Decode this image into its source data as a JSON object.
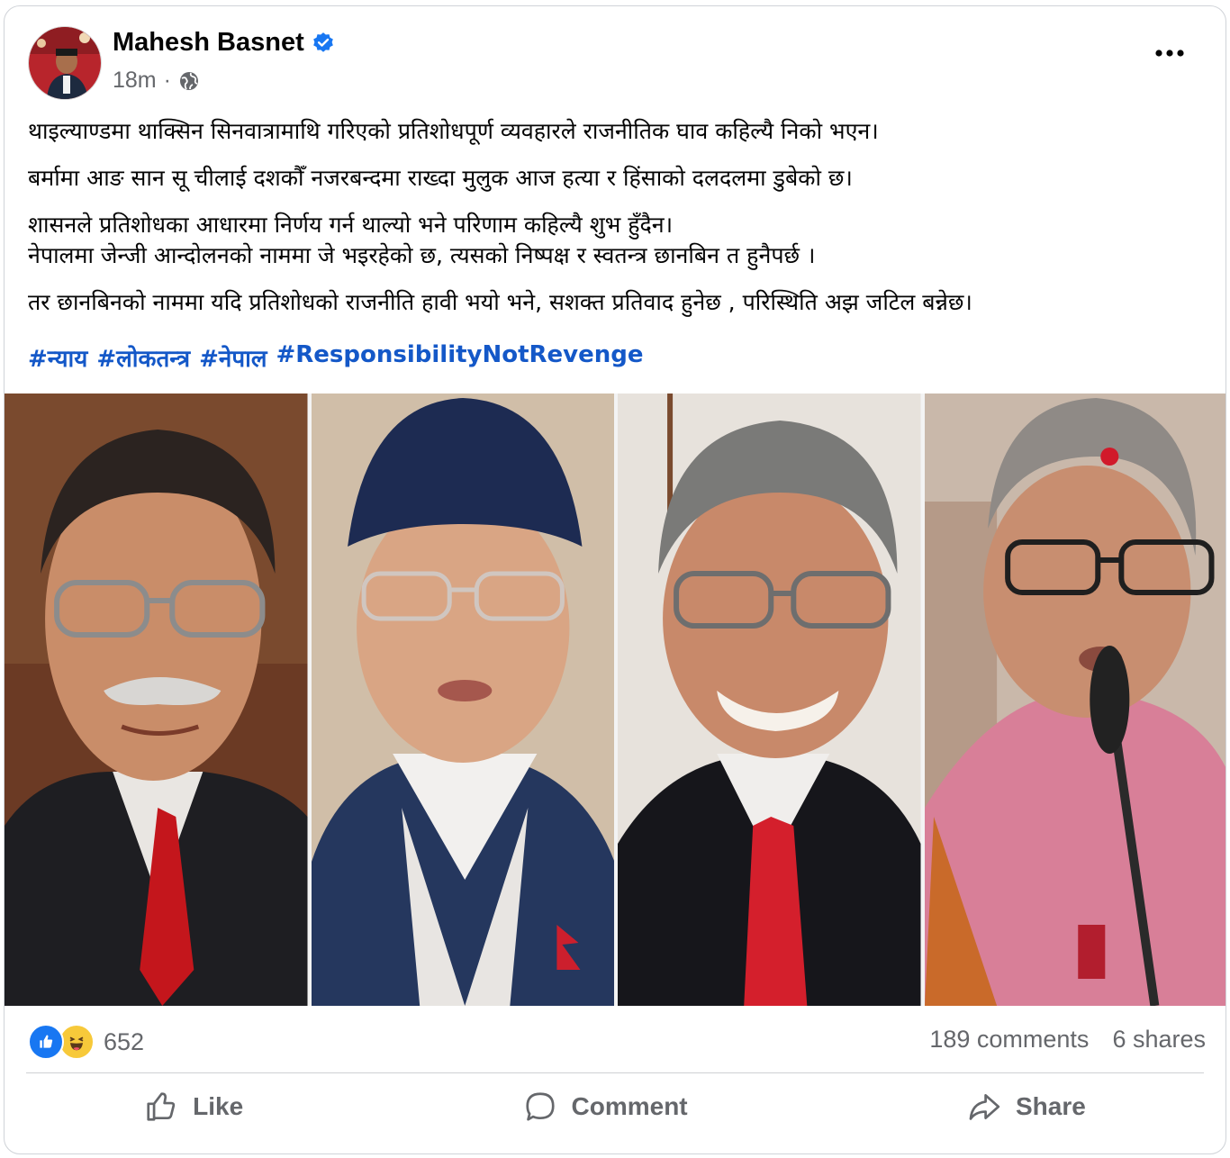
{
  "post": {
    "author": "Mahesh Basnet",
    "time": "18m",
    "separator": "·",
    "paragraphs": [
      "थाइल्याण्डमा थाक्सिन सिनवात्रामाथि गरिएको प्रतिशोधपूर्ण व्यवहारले राजनीतिक घाव कहिल्यै निको भएन।",
      "बर्मामा आङ सान सू चीलाई दशकौँ नजरबन्दमा राख्दा मुलुक आज हत्या र हिंसाको दलदलमा डुबेको छ।",
      "शासनले प्रतिशोधका आधारमा निर्णय गर्न थाल्यो भने परिणाम कहिल्यै शुभ हुँदैन।",
      "नेपालमा जेन्जी आन्दोलनको नाममा जे भइरहेको छ, त्यसको निष्पक्ष र स्वतन्त्र छानबिन त हुनैपर्छ ।",
      "तर छानबिनको नाममा यदि प्रतिशोधको राजनीति हावी भयो भने, सशक्त प्रतिवाद हुनेछ , परिस्थिति अझ जटिल बन्नेछ।"
    ],
    "hashtags": [
      "#न्याय",
      "#लोकतन्त्र",
      "#नेपाल",
      "#ResponsibilityNotRevenge"
    ]
  },
  "stats": {
    "reaction_count": "652",
    "comments": "189 comments",
    "shares": "6 shares"
  },
  "actions": {
    "like": "Like",
    "comment": "Comment",
    "share": "Share"
  },
  "icons": [
    "verified-badge-icon",
    "globe-icon",
    "more-options-icon",
    "like-reaction-icon",
    "haha-reaction-icon",
    "thumbs-up-icon",
    "comment-bubble-icon",
    "share-arrow-icon"
  ],
  "colors": {
    "hashtag": "#1458c8",
    "like_blue": "#1877f2",
    "muted_text": "#65676b"
  }
}
